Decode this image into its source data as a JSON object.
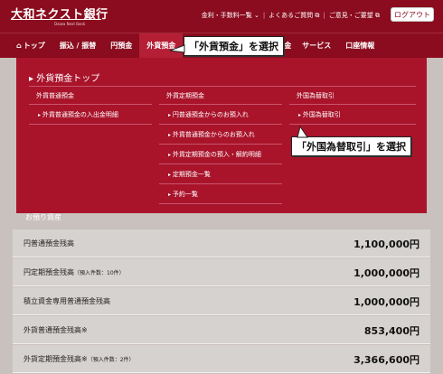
{
  "header": {
    "logo_main": "大和ネクスト銀行",
    "logo_sub": "Daiwa Next Bank",
    "links": [
      "金利・手数料一覧 ⌄",
      "よくあるご質問 ⧉",
      "ご意見・ご要望 ⧉"
    ],
    "login": "ログアウト"
  },
  "nav": {
    "items": [
      {
        "label": "トップ"
      },
      {
        "label": "振込 / 振替"
      },
      {
        "label": "円預金"
      },
      {
        "label": "外貨預金"
      },
      {
        "label": ""
      },
      {
        "label": "金"
      },
      {
        "label": "サービス"
      },
      {
        "label": "口座情報"
      }
    ]
  },
  "dropdown": {
    "title": "▸ 外貨預金トップ",
    "columns": [
      {
        "head": "外貨普通預金",
        "items": [
          "外貨普通預金の入出金明細"
        ]
      },
      {
        "head": "外貨定期預金",
        "items": [
          "円普通預金からのお預入れ",
          "外貨普通預金からのお預入れ",
          "外貨定期預金の預入・解約明細",
          "定期預金一覧",
          "予約一覧"
        ]
      },
      {
        "head": "外国為替取引",
        "items": [
          "外国為替取引"
        ]
      }
    ]
  },
  "callouts": {
    "c1": "「外貨預金」を選択",
    "c2": "「外国為替取引」を選択"
  },
  "assets": {
    "title": "お預り資産",
    "rows": [
      {
        "label": "円普通預金残高",
        "note": "",
        "value": "1,100,000円"
      },
      {
        "label": "円定期預金残高",
        "note": "（預入件数：10件）",
        "value": "1,000,000円"
      },
      {
        "label": "積立資金専用普通預金残高",
        "note": "",
        "value": "1,000,000円"
      },
      {
        "label": "外貨普通預金残高※",
        "note": "",
        "value": "853,400円"
      },
      {
        "label": "外貨定期預金残高※",
        "note": "（預入件数：2件）",
        "value": "3,366,600円"
      }
    ]
  }
}
